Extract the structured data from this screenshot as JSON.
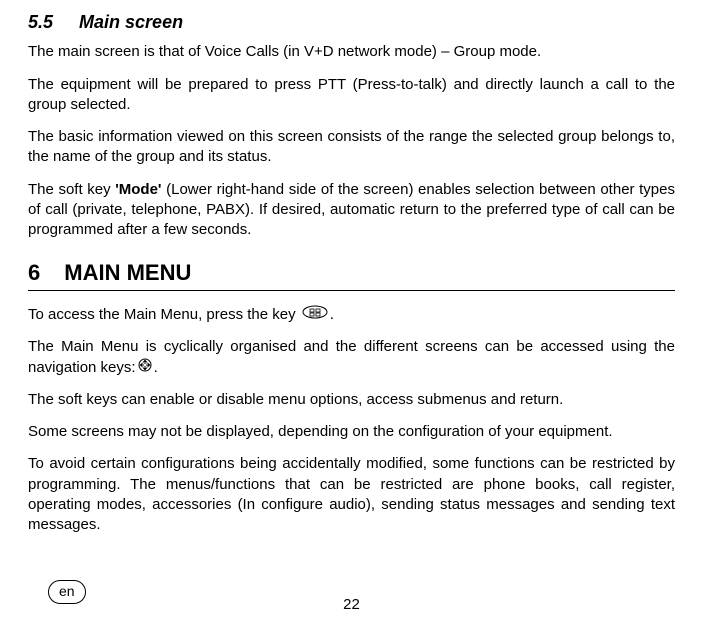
{
  "section55": {
    "number": "5.5",
    "title": "Main screen",
    "p1": "The main screen is that of Voice Calls (in V+D network mode) – Group mode.",
    "p2": "The equipment will be prepared to press PTT (Press-to-talk) and directly launch a call to the group selected.",
    "p3": "The basic information viewed on this screen consists of the range the selected group belongs to, the name of the group and its status.",
    "p4_a": "The soft key ",
    "p4_b": "'Mode'",
    "p4_c": " (Lower right-hand side of the screen) enables selection between other types of call (private, telephone, PABX). If desired, automatic return to the preferred type of call can be programmed after a few seconds."
  },
  "chapter6": {
    "number": "6",
    "title": "MAIN MENU",
    "p1_a": "To access the Main Menu, press the key ",
    "p1_b": ".",
    "p2_a": "The Main Menu is cyclically organised and the different screens can be accessed using the navigation keys:",
    "p2_b": ".",
    "p3": "The soft keys can enable or disable menu options, access submenus and return.",
    "p4": "Some screens may not be displayed, depending on the configuration of your equipment.",
    "p5": "To avoid certain configurations being accidentally modified, some functions can be restricted by programming. The menus/functions that can be restricted are phone books, call register, operating modes, accessories (In configure audio), sending status messages and sending text messages."
  },
  "footer": {
    "page_number": "22",
    "lang": "en"
  }
}
